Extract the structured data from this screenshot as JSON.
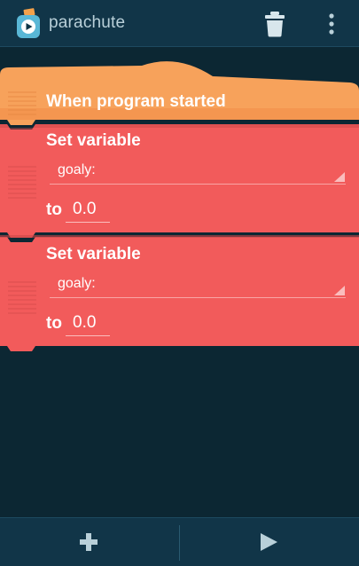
{
  "app": {
    "title": "parachute",
    "icons": {
      "logo": "pocket-code-logo",
      "delete": "trash-icon",
      "menu": "overflow-menu-icon",
      "add": "plus-icon",
      "play": "play-icon"
    }
  },
  "script": {
    "hat_block": {
      "label": "When program started",
      "color": "#f7a25b"
    },
    "set_blocks": [
      {
        "label": "Set variable",
        "variable": "goaly:",
        "to_label": "to",
        "value": "0.0",
        "color": "#f25b5b"
      },
      {
        "label": "Set variable",
        "variable": "goaly:",
        "to_label": "to",
        "value": "0.0",
        "color": "#f25b5b"
      }
    ]
  },
  "colors": {
    "appbar": "#113548",
    "canvas": "#0c2733",
    "icon": "#b9d0d9"
  }
}
